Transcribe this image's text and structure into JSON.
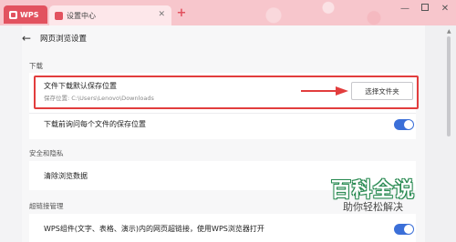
{
  "tabs": [
    {
      "label": "WPS"
    },
    {
      "label": "设置中心"
    }
  ],
  "header": {
    "title": "网页浏览设置"
  },
  "sections": {
    "download": {
      "label": "下载",
      "rows": [
        {
          "title": "文件下载默认保存位置",
          "subtitle": "保存位置: C:\\Users\\Lenovo\\Downloads",
          "button": "选择文件夹"
        },
        {
          "title": "下载前询问每个文件的保存位置",
          "toggle": true
        }
      ]
    },
    "privacy": {
      "label": "安全和隐私",
      "rows": [
        {
          "title": "清除浏览数据"
        }
      ]
    },
    "hyperlink": {
      "label": "超链接管理",
      "rows": [
        {
          "title": "WPS组件(文字、表格、演示)内的网页超链接，使用WPS浏览器打开",
          "toggle": true
        }
      ]
    }
  },
  "watermark": {
    "title": "百科全说",
    "subtitle": "助你轻松解决"
  },
  "colors": {
    "accent": "#e2525f",
    "toggle_on": "#3b6fd8",
    "highlight": "#e23d3d"
  }
}
